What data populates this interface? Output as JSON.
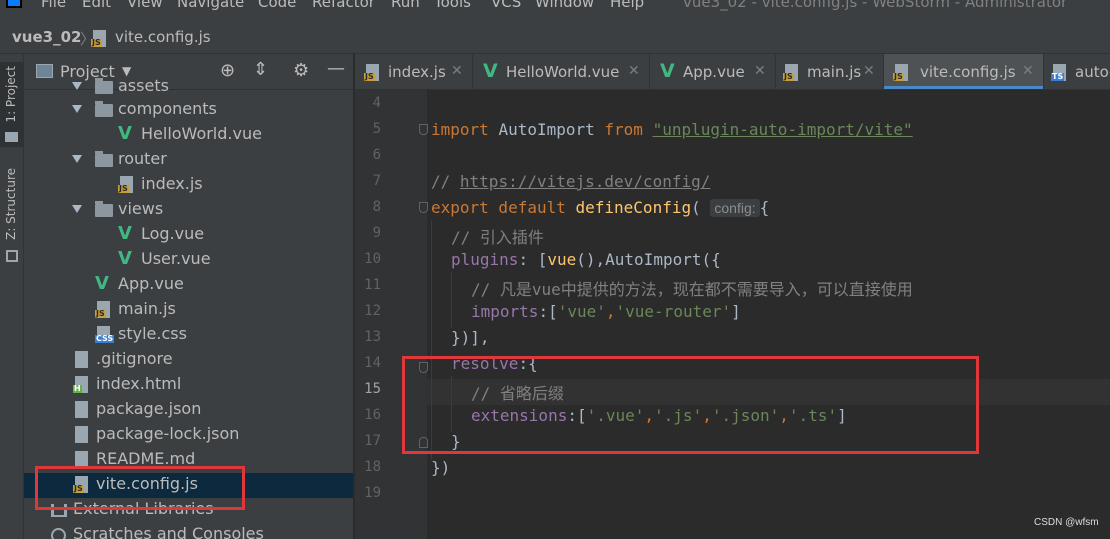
{
  "menu": {
    "items": [
      "File",
      "Edit",
      "View",
      "Navigate",
      "Code",
      "Refactor",
      "Run",
      "Tools",
      "VCS",
      "Window",
      "Help"
    ],
    "window_title": "vue3_02 - vite.config.js - WebStorm - Administrator"
  },
  "breadcrumb": {
    "project": "vue3_02",
    "file": "vite.config.js"
  },
  "tool_strip": {
    "project_tab": "1: Project",
    "structure_tab": "Z: Structure"
  },
  "project_panel": {
    "title": "Project",
    "tree": [
      {
        "label": "assets",
        "kind": "folder",
        "expanded": true
      },
      {
        "label": "components",
        "kind": "folder",
        "expanded": true
      },
      {
        "label": "HelloWorld.vue",
        "kind": "vue"
      },
      {
        "label": "router",
        "kind": "folder",
        "expanded": true
      },
      {
        "label": "index.js",
        "kind": "js"
      },
      {
        "label": "views",
        "kind": "folder",
        "expanded": true
      },
      {
        "label": "Log.vue",
        "kind": "vue"
      },
      {
        "label": "User.vue",
        "kind": "vue"
      },
      {
        "label": "App.vue",
        "kind": "vue"
      },
      {
        "label": "main.js",
        "kind": "js"
      },
      {
        "label": "style.css",
        "kind": "css"
      },
      {
        "label": ".gitignore",
        "kind": "file"
      },
      {
        "label": "index.html",
        "kind": "html"
      },
      {
        "label": "package.json",
        "kind": "json"
      },
      {
        "label": "package-lock.json",
        "kind": "json"
      },
      {
        "label": "README.md",
        "kind": "file"
      },
      {
        "label": "vite.config.js",
        "kind": "js",
        "selected": true
      },
      {
        "label": "External Libraries",
        "kind": "lib"
      },
      {
        "label": "Scratches and Consoles",
        "kind": "scratch"
      }
    ]
  },
  "editor_tabs": [
    {
      "label": "index.js",
      "kind": "js"
    },
    {
      "label": "HelloWorld.vue",
      "kind": "vue"
    },
    {
      "label": "App.vue",
      "kind": "vue"
    },
    {
      "label": "main.js",
      "kind": "js"
    },
    {
      "label": "vite.config.js",
      "kind": "js",
      "active": true
    },
    {
      "label": "auto-",
      "kind": "ts"
    }
  ],
  "editor": {
    "line_numbers": [
      "4",
      "5",
      "6",
      "7",
      "8",
      "9",
      "10",
      "11",
      "12",
      "13",
      "14",
      "15",
      "16",
      "17",
      "18",
      "19"
    ],
    "current_line": "15",
    "code": {
      "l5_import": "import",
      "l5_name": "AutoImport",
      "l5_from": "from",
      "l5_module": "\"unplugin-auto-import/vite\"",
      "l7_comment": "//",
      "l7_url": "https://vitejs.dev/config/",
      "l8_export": "export default",
      "l8_fn": "defineConfig",
      "l8_paren": "(",
      "l8_hint": "config:",
      "l8_brace": "{",
      "l9_comment": "// 引入插件",
      "l10_key": "plugins",
      "l10_rest_a": ": [",
      "l10_vue": "vue",
      "l10_rest_b": "(),AutoImport({",
      "l11_comment": "// 凡是vue中提供的方法，现在都不需要导入，可以直接使用",
      "l12_key": "imports",
      "l12_rest_a": ":[",
      "l12_s1": "'vue'",
      "l12_comma": ",",
      "l12_s2": "'vue-router'",
      "l12_rest_b": "]",
      "l13": "})],",
      "l14_key": "resolve",
      "l14_rest": ":{",
      "l15_comment": "// 省略后缀",
      "l16_key": "extensions",
      "l16_rest_a": ":[",
      "l16_s1": "'.vue'",
      "l16_c1": ",",
      "l16_s2": "'.js'",
      "l16_c2": ",",
      "l16_s3": "'.json'",
      "l16_c3": ",",
      "l16_s4": "'.ts'",
      "l16_rest_b": "]",
      "l17": "}",
      "l18": "})"
    }
  },
  "watermark": "CSDN @wfsm",
  "colors": {
    "annotation_box": "#e0373b",
    "selection": "#0d293e",
    "active_tab_underline": "#4a88c7"
  }
}
